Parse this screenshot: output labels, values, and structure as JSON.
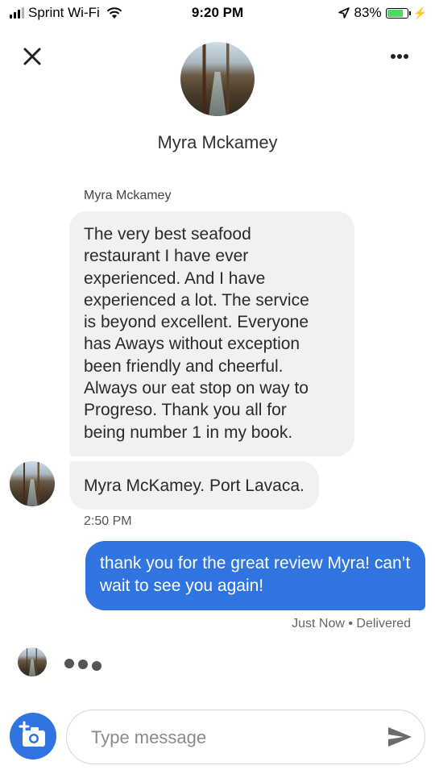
{
  "status_bar": {
    "carrier": "Sprint Wi-Fi",
    "time": "9:20 PM",
    "battery": "83%",
    "battery_level": 0.83,
    "icons": [
      "signal-bars-icon",
      "wifi-icon",
      "location-arrow-icon",
      "battery-icon",
      "charging-bolt-icon"
    ]
  },
  "header": {
    "contact_name": "Myra Mckamey",
    "close_icon": "close-icon",
    "more_icon": "more-options-icon"
  },
  "conversation": {
    "sender_label": "Myra Mckamey",
    "incoming": [
      {
        "text": "The very best seafood\nrestaurant  I  have ever\nexperienced.  And I  have\nexperienced a lot. The service\nis beyond excellent.  Everyone\nhas Aways without exception\nbeen friendly and cheerful.\nAlways our eat stop on way to\nProgreso.  Thank you all for\nbeing number 1 in my book."
      },
      {
        "text": "Myra McKamey. Port Lavaca."
      }
    ],
    "incoming_time": "2:50 PM",
    "outgoing": {
      "text": "thank you for the great review Myra! can’t wait to see you again!"
    },
    "delivery_status": "Just Now • Delivered"
  },
  "composer": {
    "placeholder": "Type message",
    "value": "",
    "camera_icon": "add-photo-icon",
    "send_icon": "send-icon"
  },
  "colors": {
    "accent": "#2f74e0",
    "incoming_bubble": "#f1f1f1",
    "battery_green": "#4cd964"
  }
}
